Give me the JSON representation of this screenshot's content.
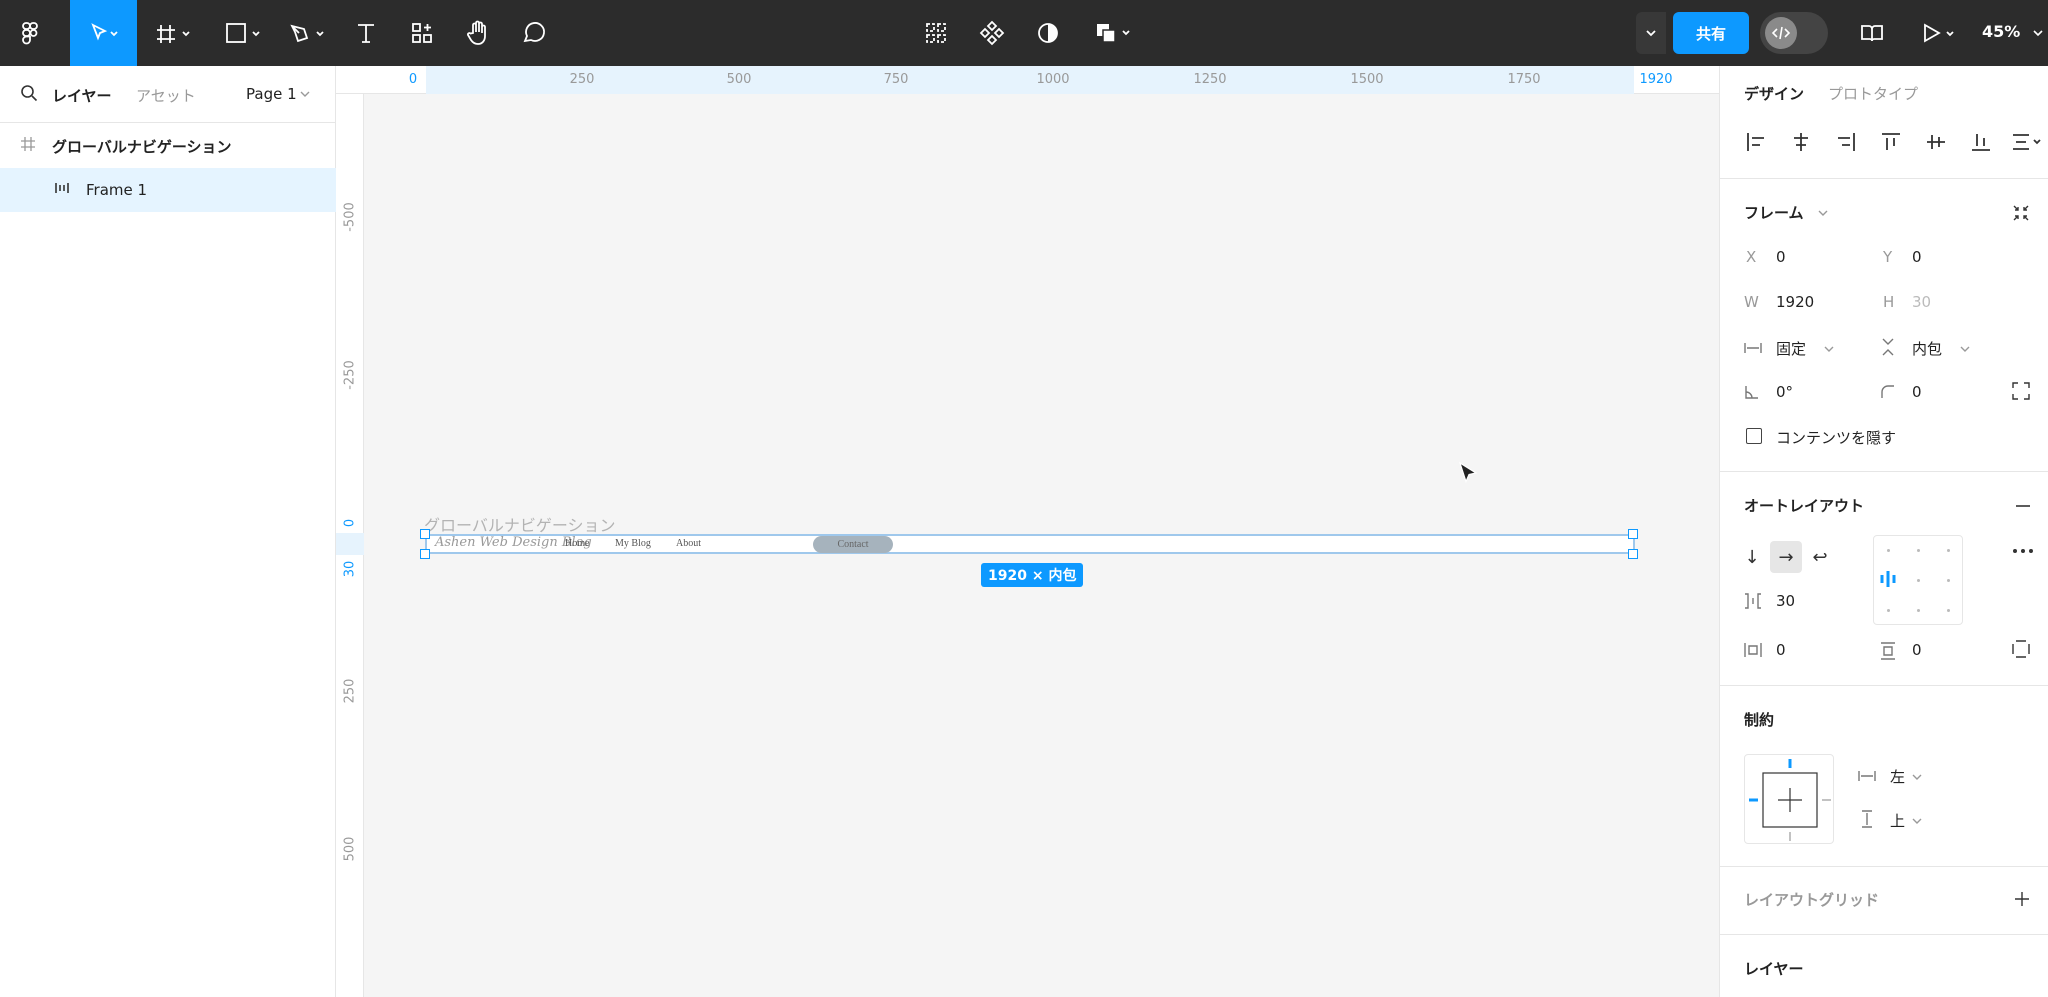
{
  "toolbar": {
    "share_label": "共有",
    "zoom_label": "45%",
    "icons": [
      "figma-menu-icon",
      "move-tool-icon",
      "frame-tool-icon",
      "shape-tool-icon",
      "pen-tool-icon",
      "text-tool-icon",
      "resources-icon",
      "hand-tool-icon",
      "comment-icon",
      "component-set-icon",
      "component-icon",
      "mask-icon",
      "boolean-icon",
      "dev-mode-icon",
      "library-icon",
      "present-icon"
    ]
  },
  "left_panel": {
    "tabs": {
      "layers": "レイヤー",
      "assets": "アセット"
    },
    "page_selector": "Page 1",
    "layers": [
      {
        "name": "グローバルナビゲーション",
        "icon": "frame-icon"
      },
      {
        "name": "Frame 1",
        "icon": "auto-layout-icon"
      }
    ]
  },
  "rulers": {
    "top": [
      "0",
      "250",
      "500",
      "750",
      "1000",
      "1250",
      "1500",
      "1750",
      "1920"
    ],
    "left": [
      "-500",
      "-250",
      "0",
      "30",
      "250",
      "500"
    ]
  },
  "canvas": {
    "frame_name": "グローバルナビゲーション",
    "nav": {
      "logo": "Ashen Web Design Blog",
      "links": [
        "Home",
        "My Blog",
        "About"
      ],
      "contact": "Contact"
    },
    "size_badge": "1920 × 内包"
  },
  "right_panel": {
    "tabs": {
      "design": "デザイン",
      "prototype": "プロトタイプ"
    },
    "frame": {
      "title": "フレーム",
      "x_label": "X",
      "x_value": "0",
      "y_label": "Y",
      "y_value": "0",
      "w_label": "W",
      "w_value": "1920",
      "h_label": "H",
      "h_value": "30",
      "width_mode": "固定",
      "height_mode": "内包",
      "rotation": "0°",
      "radius": "0",
      "clip_label": "コンテンツを隠す"
    },
    "auto_layout": {
      "title": "オートレイアウト",
      "gap": "30",
      "padding_h": "0",
      "padding_v": "0"
    },
    "constraints": {
      "title": "制約",
      "horizontal": "左",
      "vertical": "上"
    },
    "layout_grid_title": "レイアウトグリッド",
    "layer_title": "レイヤー"
  }
}
